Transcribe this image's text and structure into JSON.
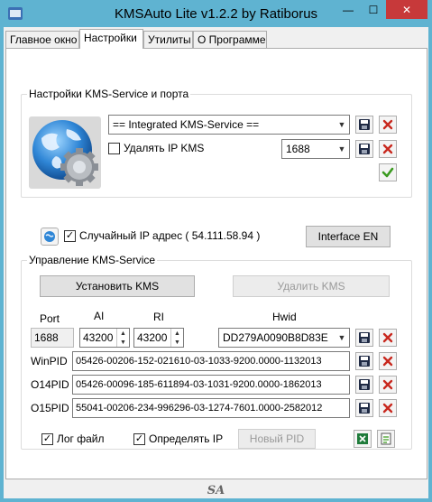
{
  "window": {
    "title": "KMSAuto Lite v1.2.2 by Ratiborus",
    "min_glyph": "—",
    "max_glyph": "☐",
    "close_glyph": "✕"
  },
  "tabs": [
    {
      "label": "Главное окно"
    },
    {
      "label": "Настройки"
    },
    {
      "label": "Утилиты"
    },
    {
      "label": "О Программе"
    }
  ],
  "kms_settings": {
    "group_label": "Настройки KMS-Service и порта",
    "service_value": "== Integrated KMS-Service ==",
    "delete_ip_label": "Удалять IP KMS",
    "delete_ip_checked": false,
    "port_value": "1688"
  },
  "random_ip": {
    "label": "Случайный IP адрес ( 54.111.58.94 )",
    "checked": true,
    "interface_button": "Interface EN"
  },
  "service_mgmt": {
    "group_label": "Управление KMS-Service",
    "install_button": "Установить KMS",
    "remove_button": "Удалить KMS",
    "headers": {
      "port": "Port",
      "ai": "AI",
      "ri": "RI",
      "hwid": "Hwid"
    },
    "port_value": "1688",
    "ai_value": "43200",
    "ri_value": "43200",
    "hwid_value": "DD279A0090B8D83E",
    "pids": [
      {
        "label": "WinPID",
        "value": "05426-00206-152-021610-03-1033-9200.0000-1132013"
      },
      {
        "label": "O14PID",
        "value": "05426-00096-185-611894-03-1031-9200.0000-1862013"
      },
      {
        "label": "O15PID",
        "value": "55041-00206-234-996296-03-1274-7601.0000-2582012"
      }
    ],
    "log_file_label": "Лог файл",
    "log_file_checked": true,
    "detect_ip_label": "Определять IP",
    "detect_ip_checked": true,
    "new_pid_button": "Новый PID"
  },
  "footer": {
    "logo": "SA"
  },
  "colors": {
    "title_bar": "#5fb3d1",
    "close_button": "#c7393a",
    "save_icon": "#1f2a44",
    "delete_icon": "#c8281e",
    "ok_icon": "#3a9a1f"
  }
}
